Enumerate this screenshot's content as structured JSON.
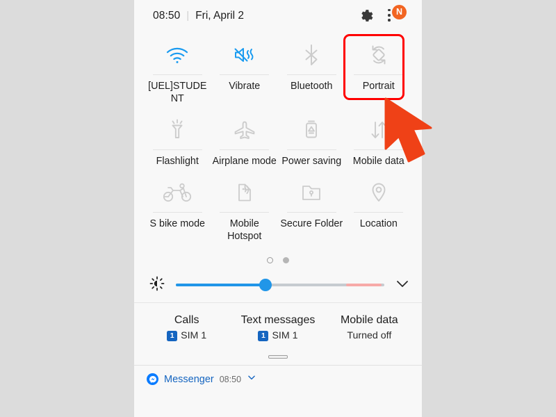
{
  "theme": {
    "page_background": "#dcdcdc",
    "panel_background": "#f8f8f8",
    "active_icon": "#2196e8",
    "inactive_icon": "#c9c9c9",
    "highlight_border": "#ff0000",
    "cursor_color": "#ef4117",
    "badge_orange": "#f26522",
    "sim_blue": "#1565c0",
    "slider_blue": "#2196e8",
    "slider_hot": "#f7aaa8"
  },
  "header": {
    "time": "08:50",
    "separator": "|",
    "date": "Fri, April 2",
    "settings_icon": "gear-icon",
    "overflow_icon": "kebab-menu-icon",
    "badge_label": "N"
  },
  "quick_settings": {
    "rows": [
      {
        "tiles": [
          {
            "label": "[UEL]STUDENT",
            "icon": "wifi-icon",
            "state": "on"
          },
          {
            "label": "Vibrate",
            "icon": "vibrate-icon",
            "state": "on"
          },
          {
            "label": "Bluetooth",
            "icon": "bluetooth-icon",
            "state": "off"
          },
          {
            "label": "Portrait",
            "icon": "screen-rotation-icon",
            "state": "off",
            "highlighted": true
          }
        ]
      },
      {
        "tiles": [
          {
            "label": "Flashlight",
            "icon": "flashlight-icon",
            "state": "off"
          },
          {
            "label": "Airplane mode",
            "icon": "airplane-icon",
            "state": "off"
          },
          {
            "label": "Power saving",
            "icon": "battery-saver-icon",
            "state": "off"
          },
          {
            "label": "Mobile data",
            "icon": "mobile-data-icon",
            "state": "off"
          }
        ]
      },
      {
        "tiles": [
          {
            "label": "S bike mode",
            "icon": "motorbike-icon",
            "state": "off"
          },
          {
            "label": "Mobile Hotspot",
            "icon": "hotspot-icon",
            "state": "off"
          },
          {
            "label": "Secure Folder",
            "icon": "secure-folder-icon",
            "state": "off"
          },
          {
            "label": "Location",
            "icon": "location-pin-icon",
            "state": "off"
          }
        ]
      }
    ],
    "page_indicator": {
      "total": 2,
      "current": 1
    }
  },
  "brightness": {
    "icon": "brightness-icon",
    "value_percent": 43,
    "expand_icon": "chevron-down-icon"
  },
  "sim_status": [
    {
      "title": "Calls",
      "badge": "1",
      "value": "SIM 1"
    },
    {
      "title": "Text messages",
      "badge": "1",
      "value": "SIM 1"
    },
    {
      "title": "Mobile data",
      "badge": "",
      "value": "Turned off"
    }
  ],
  "panel_handle": {
    "icon": "drag-handle-icon"
  },
  "notification": {
    "app": "Messenger",
    "time": "08:50",
    "expand_icon": "chevron-down-icon"
  },
  "annotation": {
    "highlight_target": "Portrait",
    "cursor": "mouse-pointer-arrow"
  }
}
